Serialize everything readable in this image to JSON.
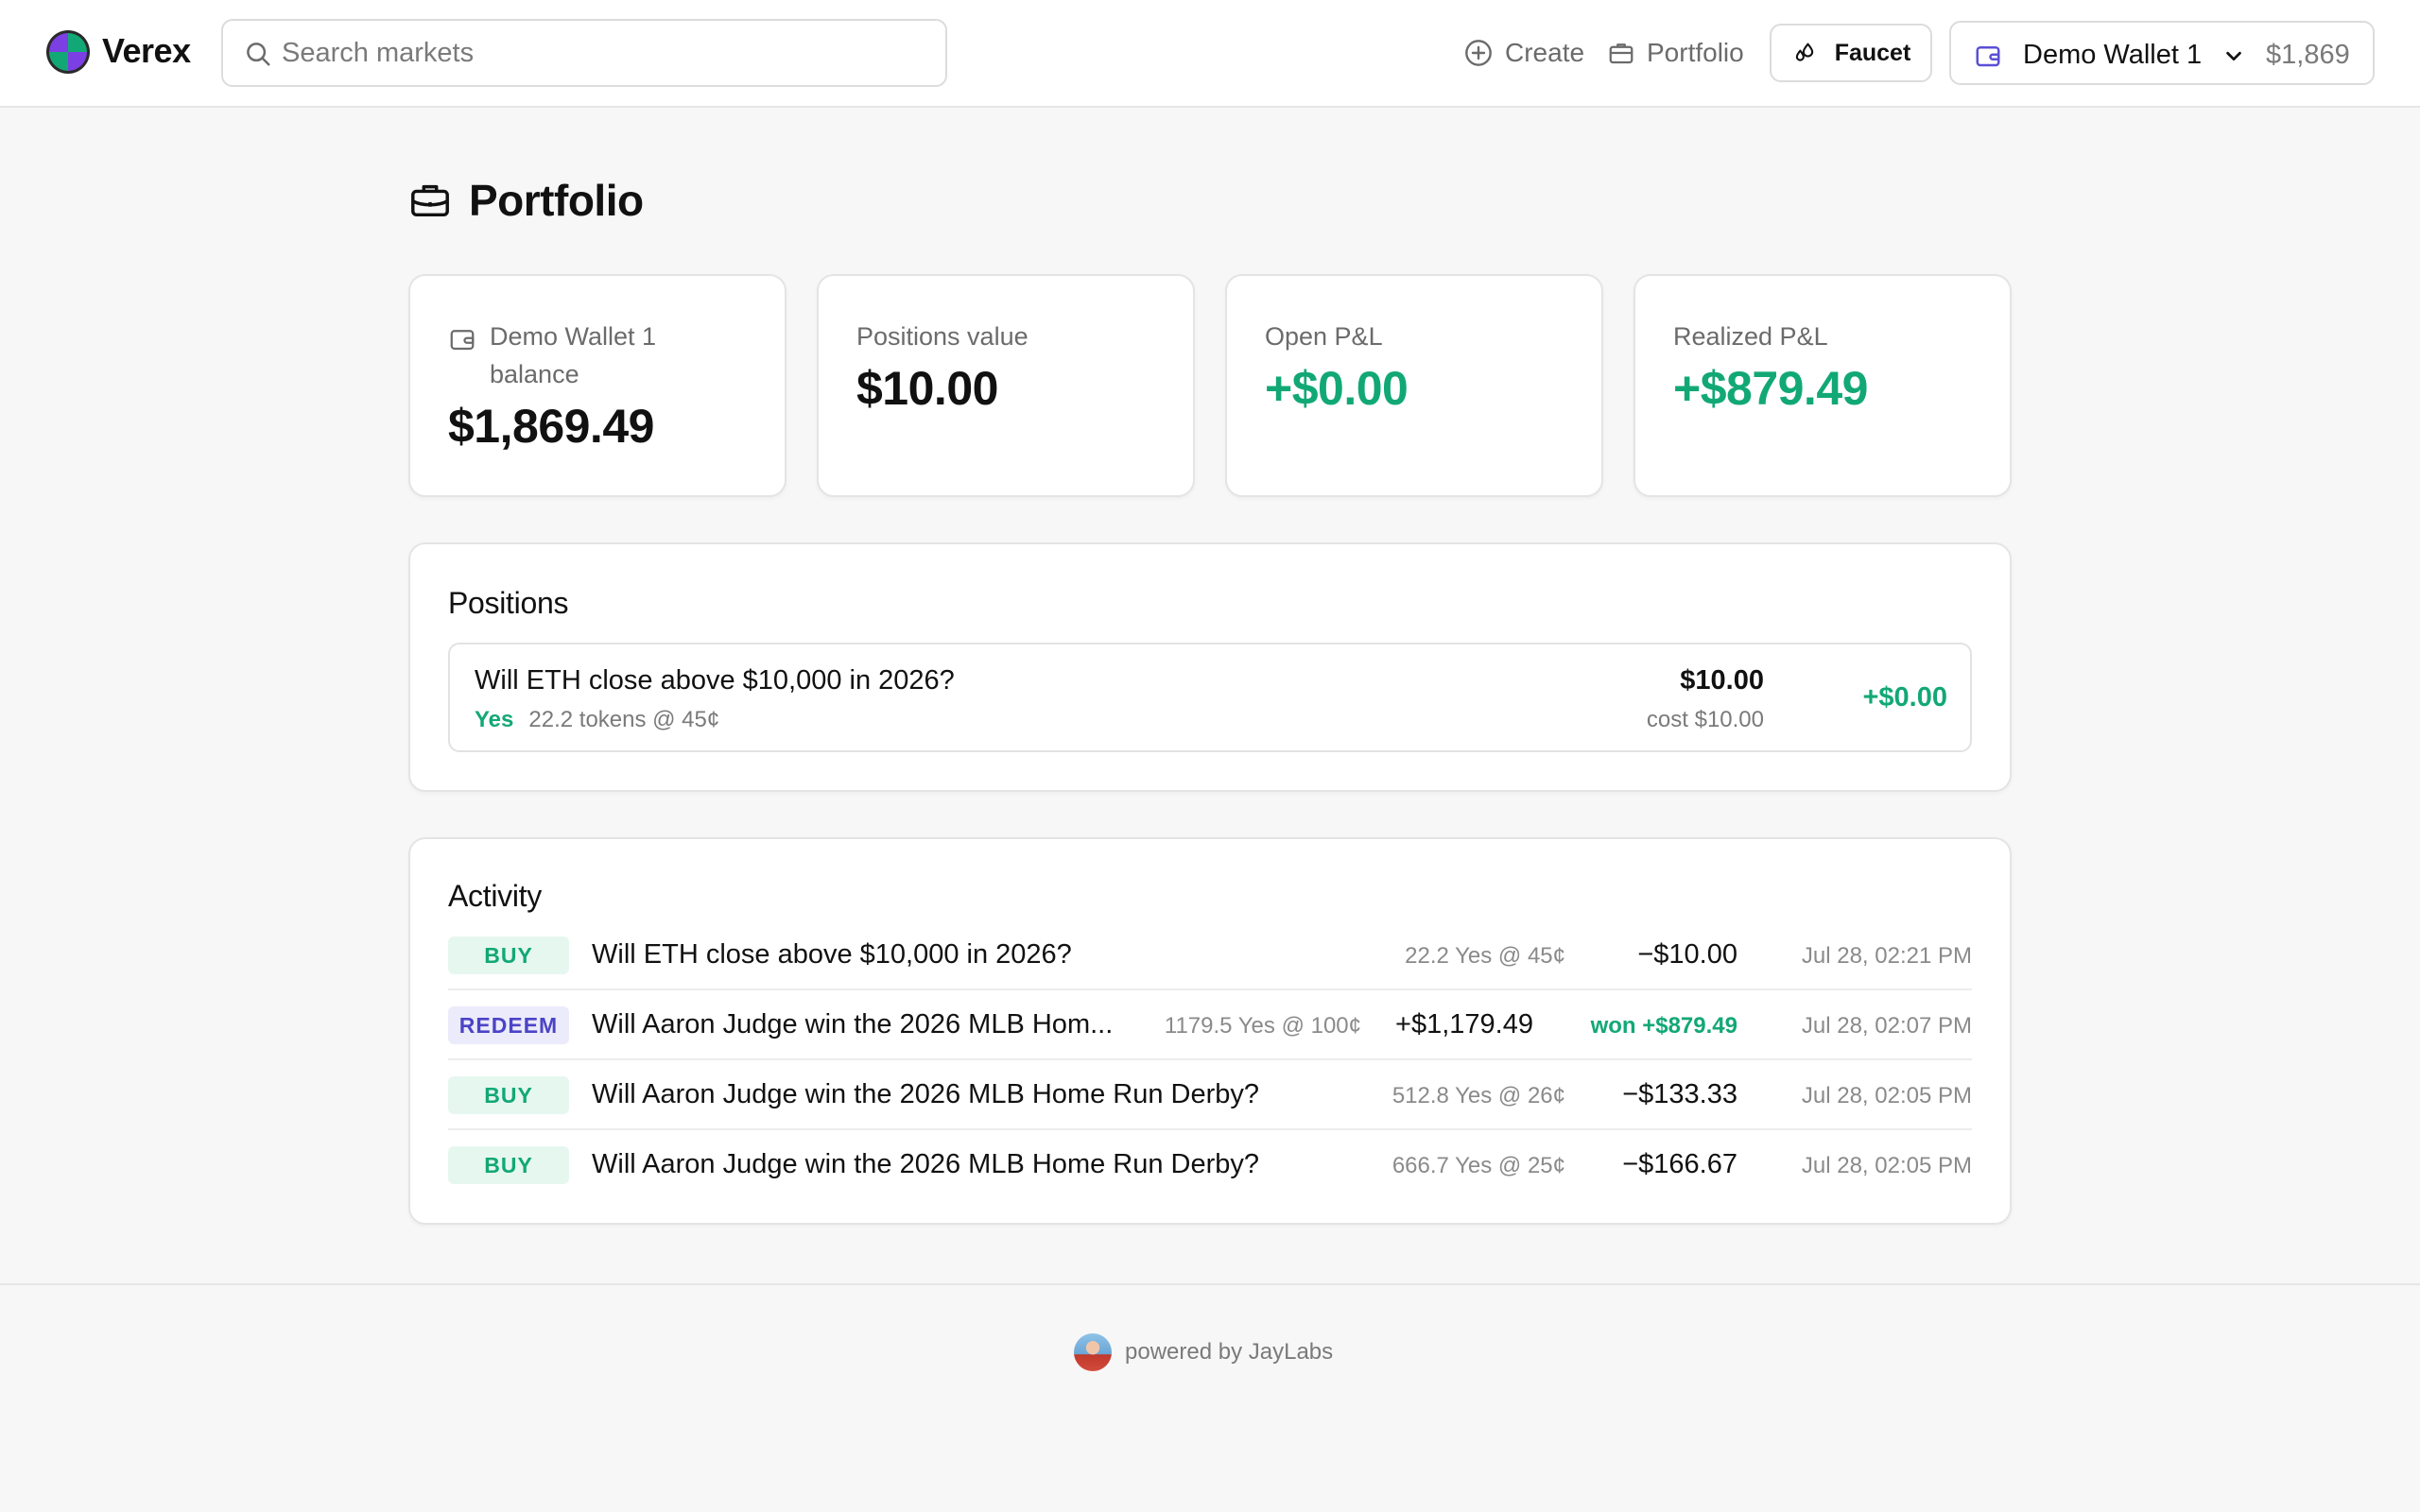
{
  "header": {
    "brand": "Verex",
    "search_placeholder": "Search markets",
    "nav": {
      "create_label": "Create",
      "portfolio_label": "Portfolio"
    },
    "faucet_label": "Faucet",
    "wallet": {
      "name": "Demo Wallet 1",
      "balance": "$1,869"
    }
  },
  "page": {
    "title": "Portfolio"
  },
  "stats": {
    "balance": {
      "label": "Demo Wallet 1 balance",
      "value": "$1,869.49"
    },
    "positions_value": {
      "label": "Positions value",
      "value": "$10.00"
    },
    "open_pnl": {
      "label": "Open P&L",
      "value": "+$0.00"
    },
    "realized_pnl": {
      "label": "Realized P&L",
      "value": "+$879.49"
    }
  },
  "positions": {
    "title": "Positions",
    "items": [
      {
        "question": "Will ETH close above $10,000 in 2026?",
        "side": "Yes",
        "detail": "22.2 tokens @ 45¢",
        "value": "$10.00",
        "cost": "cost $10.00",
        "pnl": "+$0.00"
      }
    ]
  },
  "activity": {
    "title": "Activity",
    "items": [
      {
        "type": "BUY",
        "question": "Will ETH close above $10,000 in 2026?",
        "meta": "22.2 Yes @ 45¢",
        "amount": "−$10.00",
        "won": "",
        "time": "Jul 28, 02:21 PM"
      },
      {
        "type": "REDEEM",
        "question": "Will Aaron Judge win the 2026 MLB Hom...",
        "meta": "1179.5 Yes @ 100¢",
        "amount": "+$1,179.49",
        "won": "won +$879.49",
        "time": "Jul 28, 02:07 PM"
      },
      {
        "type": "BUY",
        "question": "Will Aaron Judge win the 2026 MLB Home Run Derby?",
        "meta": "512.8 Yes @ 26¢",
        "amount": "−$133.33",
        "won": "",
        "time": "Jul 28, 02:05 PM"
      },
      {
        "type": "BUY",
        "question": "Will Aaron Judge win the 2026 MLB Home Run Derby?",
        "meta": "666.7 Yes @ 25¢",
        "amount": "−$166.67",
        "won": "",
        "time": "Jul 28, 02:05 PM"
      }
    ]
  },
  "footer": {
    "powered_by": "powered by JayLabs"
  },
  "colors": {
    "positive": "#12a876",
    "redeem": "#4b44c6",
    "wallet_icon": "#5b4fd6"
  },
  "icons": [
    "verex-logo",
    "search-icon",
    "plus-circle-icon",
    "briefcase-icon",
    "droplets-icon",
    "wallet-icon",
    "chevron-down-icon",
    "avatar"
  ]
}
